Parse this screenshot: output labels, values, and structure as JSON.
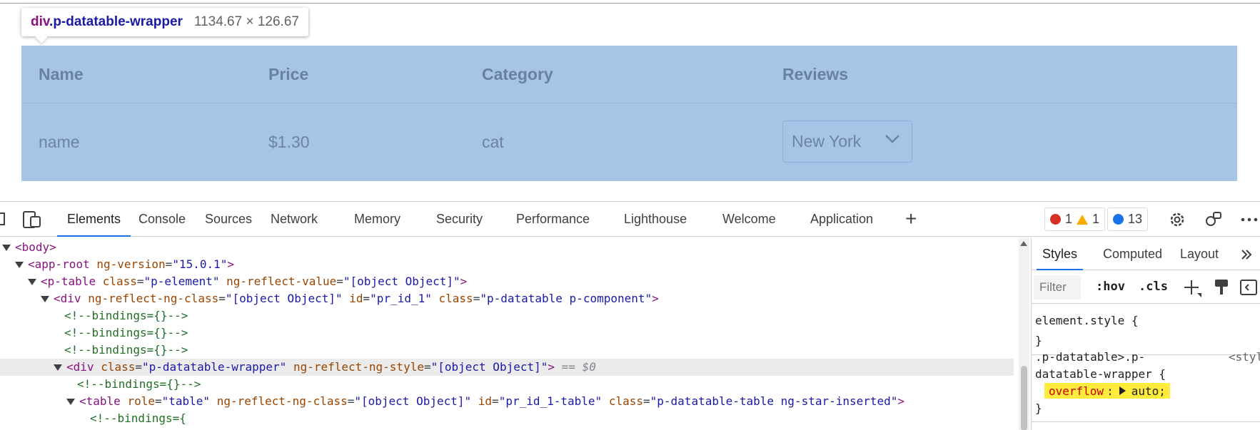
{
  "page": {
    "tooltip": {
      "tag": "div",
      "class_name": ".p-datatable-wrapper",
      "dimensions": "1134.67 × 126.67"
    },
    "table": {
      "headers": [
        "Name",
        "Price",
        "Category",
        "Reviews"
      ],
      "row": {
        "name": "name",
        "price": "$1.30",
        "category": "cat",
        "city": "New York"
      }
    }
  },
  "devtools": {
    "tabs": [
      "Elements",
      "Console",
      "Sources",
      "Network",
      "Memory",
      "Security",
      "Performance",
      "Lighthouse",
      "Welcome",
      "Application"
    ],
    "active_tab": "Elements",
    "counters": {
      "errors": "1",
      "warnings": "1",
      "messages": "13"
    },
    "colors": {
      "error": "#d93025",
      "warning": "#f9ab00",
      "message": "#1a73e8",
      "highlight": "#ffeb3b"
    },
    "dom": {
      "body": "<body>",
      "app_root": {
        "tag": "app-root",
        "attr": "ng-version",
        "val": "\"15.0.1\""
      },
      "p_table": {
        "tag": "p-table",
        "attr1": "class",
        "val1": "\"p-element\"",
        "attr2": "ng-reflect-value",
        "val2": "\"[object Object]\""
      },
      "div_main": {
        "tag": "div",
        "attr1": "ng-reflect-ng-class",
        "val1": "\"[object Object]\"",
        "attr2": "id",
        "val2": "\"pr_id_1\"",
        "attr3": "class",
        "val3": "\"p-datatable p-component\""
      },
      "comment": "<!--bindings={}-->",
      "div_wrapper": {
        "tag": "div",
        "attr1": "class",
        "val1": "\"p-datatable-wrapper\"",
        "attr2": "ng-reflect-ng-style",
        "val2": "\"[object Object]\"",
        "marker": "== $0"
      },
      "table": {
        "tag": "table",
        "attr1": "role",
        "val1": "\"table\"",
        "attr2": "ng-reflect-ng-class",
        "val2": "\"[object Object]\"",
        "attr3": "id",
        "val3": "\"pr_id_1-table\"",
        "attr4": "class",
        "val4": "\"p-datatable-table ng-star-inserted\""
      },
      "comment_open": "<!--bindings={"
    },
    "styles": {
      "tabs": [
        "Styles",
        "Computed",
        "Layout"
      ],
      "filter_placeholder": "Filter",
      "hov": ":hov",
      "cls": ".cls",
      "element_style": "element.style {",
      "close_brace": "}",
      "selector_line1": ".p-datatable>.p-",
      "selector_line2": "datatable-wrapper {",
      "source": "<styl",
      "property": "overflow",
      "value": "auto;"
    }
  }
}
